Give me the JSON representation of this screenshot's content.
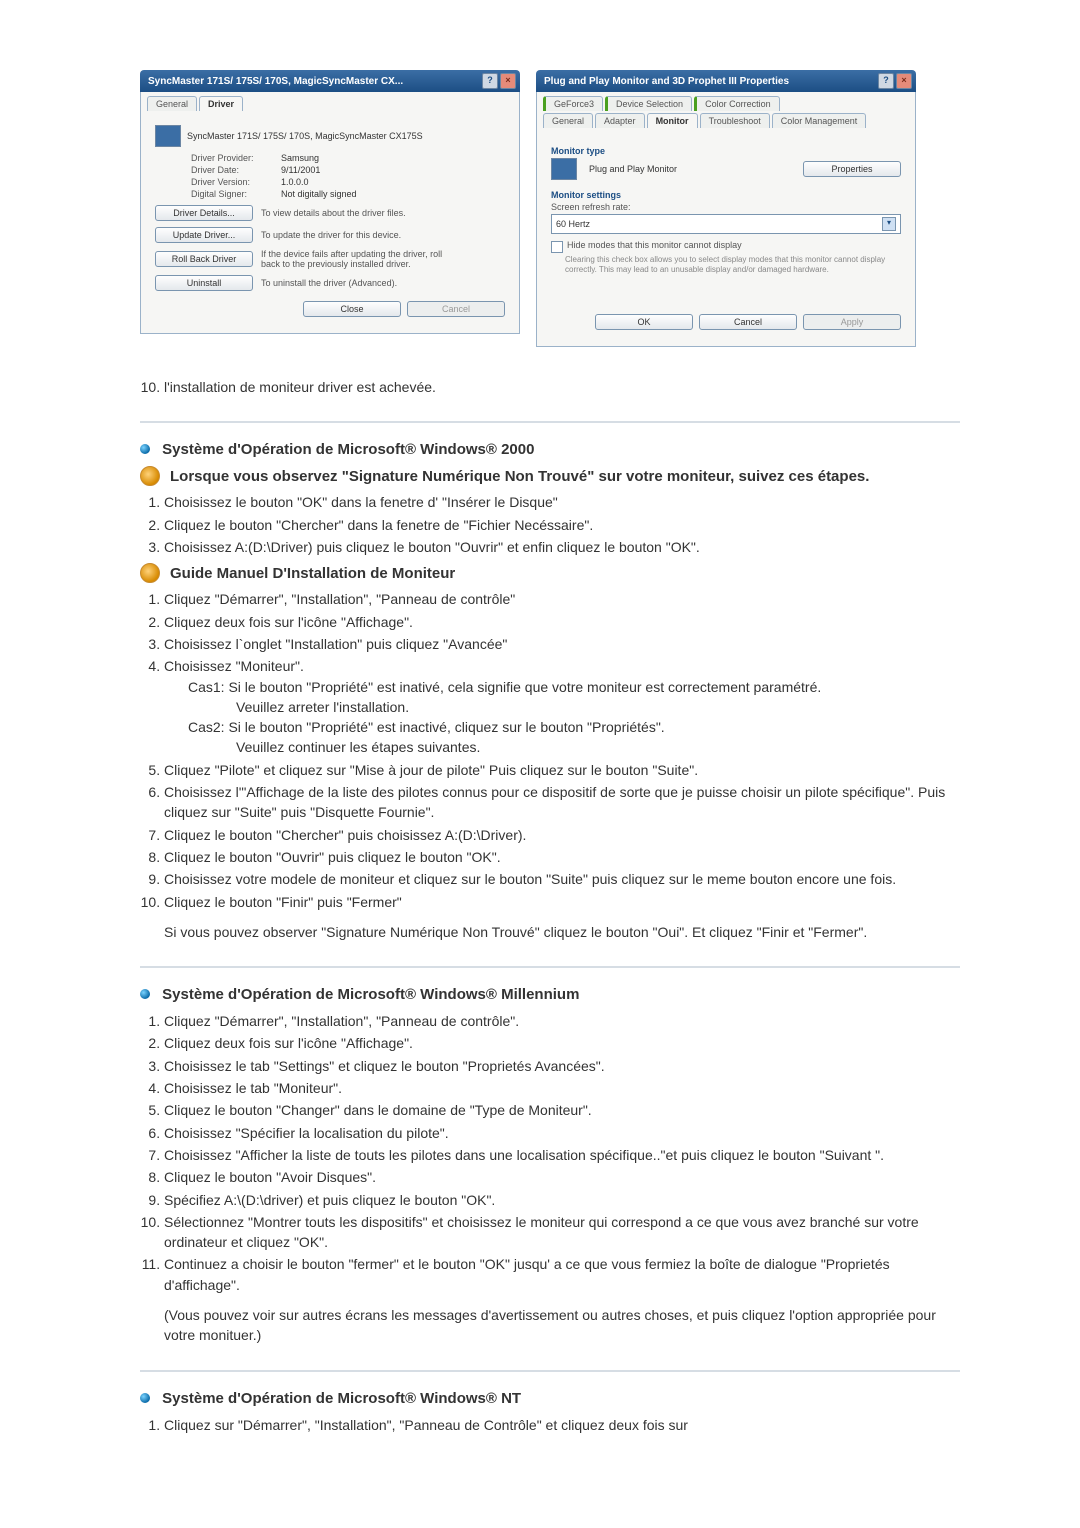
{
  "dlg1": {
    "title": "SyncMaster 171S/ 175S/ 170S, MagicSyncMaster CX...",
    "tabs": {
      "general": "General",
      "driver": "Driver"
    },
    "deviceName": "SyncMaster 171S/ 175S/ 170S, MagicSyncMaster CX175S",
    "kv": {
      "providerLabel": "Driver Provider:",
      "providerValue": "Samsung",
      "dateLabel": "Driver Date:",
      "dateValue": "9/11/2001",
      "versionLabel": "Driver Version:",
      "versionValue": "1.0.0.0",
      "signerLabel": "Digital Signer:",
      "signerValue": "Not digitally signed"
    },
    "acts": {
      "detailsBtn": "Driver Details...",
      "detailsDesc": "To view details about the driver files.",
      "updateBtn": "Update Driver...",
      "updateDesc": "To update the driver for this device.",
      "rollbackBtn": "Roll Back Driver",
      "rollbackDesc": "If the device fails after updating the driver, roll back to the previously installed driver.",
      "uninstallBtn": "Uninstall",
      "uninstallDesc": "To uninstall the driver (Advanced)."
    },
    "close": "Close",
    "cancel": "Cancel"
  },
  "dlg2": {
    "title": "Plug and Play Monitor and 3D Prophet III Properties",
    "tabs": {
      "geforce": "GeForce3",
      "devsel": "Device Selection",
      "colorcorr": "Color Correction",
      "general": "General",
      "adapter": "Adapter",
      "monitor": "Monitor",
      "troubleshoot": "Troubleshoot",
      "colormgmt": "Color Management"
    },
    "monTypeLegend": "Monitor type",
    "monTypeValue": "Plug and Play Monitor",
    "propertiesBtn": "Properties",
    "monSettingsLegend": "Monitor settings",
    "refreshLabel": "Screen refresh rate:",
    "refreshValue": "60 Hertz",
    "hideModes": "Hide modes that this monitor cannot display",
    "hideModesNote": "Clearing this check box allows you to select display modes that this monitor cannot display correctly. This may lead to an unusable display and/or damaged hardware.",
    "ok": "OK",
    "cancel": "Cancel",
    "apply": "Apply"
  },
  "step10": "l'installation de moniteur driver est achevée.",
  "sec2000": {
    "title": "Système d'Opération de Microsoft® Windows® 2000",
    "sigHead": "Lorsque vous observez \"Signature Numérique Non Trouvé\" sur votre moniteur, suivez ces étapes.",
    "sigSteps": [
      "Choisissez le bouton \"OK\" dans la fenetre d' \"Insérer le Disque\"",
      "Cliquez le bouton \"Chercher\" dans la fenetre de \"Fichier Necéssaire\".",
      "Choisissez A:(D:\\Driver) puis cliquez le bouton \"Ouvrir\" et enfin cliquez le bouton \"OK\"."
    ],
    "guideHead": "Guide Manuel D'Installation de Moniteur",
    "guideSteps": {
      "s1": "Cliquez \"Démarrer\", \"Installation\", \"Panneau de contrôle\"",
      "s2": "Cliquez deux fois sur l'icône \"Affichage\".",
      "s3": "Choisissez l`onglet \"Installation\" puis cliquez \"Avancée\"",
      "s4": "Choisissez \"Moniteur\".",
      "s4c1a": "Cas1:  Si le bouton \"Propriété\" est inativé, cela signifie que votre moniteur est correctement paramétré.",
      "s4c1b": "Veuillez arreter l'installation.",
      "s4c2a": "Cas2:  Si le bouton \"Propriété\" est inactivé, cliquez sur le bouton \"Propriétés\".",
      "s4c2b": "Veuillez continuer les étapes suivantes.",
      "s5": "Cliquez \"Pilote\" et cliquez sur \"Mise à jour de pilote\" Puis cliquez sur le bouton \"Suite\".",
      "s6": "Choisissez l'\"Affichage de la liste des pilotes connus pour ce dispositif de sorte que je puisse choisir un pilote spécifique\". Puis cliquez sur \"Suite\" puis \"Disquette Fournie\".",
      "s7": "Cliquez le bouton \"Chercher\" puis choisissez A:(D:\\Driver).",
      "s8": "Cliquez le bouton \"Ouvrir\" puis cliquez le bouton \"OK\".",
      "s9": "Choisissez votre modele de moniteur et cliquez sur le bouton \"Suite\" puis cliquez sur le meme bouton encore une fois.",
      "s10": "Cliquez le bouton \"Finir\" puis \"Fermer\""
    },
    "guideNote": "Si vous pouvez observer \"Signature Numérique Non Trouvé\" cliquez le bouton \"Oui\". Et cliquez \"Finir et \"Fermer\"."
  },
  "secMill": {
    "title": "Système d'Opération de Microsoft® Windows® Millennium",
    "steps": [
      "Cliquez \"Démarrer\", \"Installation\", \"Panneau de contrôle\".",
      "Cliquez deux fois sur l'icône \"Affichage\".",
      "Choisissez le tab \"Settings\" et cliquez le bouton \"Proprietés Avancées\".",
      "Choisissez le tab \"Moniteur\".",
      "Cliquez le bouton \"Changer\" dans le domaine de \"Type de Moniteur\".",
      "Choisissez \"Spécifier la localisation du pilote\".",
      "Choisissez \"Afficher la liste de touts les pilotes dans une localisation spécifique..\"et puis cliquez le bouton \"Suivant \".",
      "Cliquez le bouton \"Avoir Disques\".",
      "Spécifiez A:\\(D:\\driver) et puis cliquez le bouton \"OK\".",
      "Sélectionnez \"Montrer touts les dispositifs\" et choisissez le moniteur qui correspond a ce que vous avez branché sur votre ordinateur et cliquez \"OK\".",
      "Continuez a choisir le bouton \"fermer\" et le bouton \"OK\" jusqu' a ce que vous fermiez la boîte de dialogue \"Proprietés d'affichage\"."
    ],
    "note": "(Vous pouvez voir sur autres écrans les messages d'avertissement ou autres choses, et puis cliquez l'option appropriée pour votre monituer.)"
  },
  "secNT": {
    "title": "Système d'Opération de Microsoft® Windows® NT",
    "steps": [
      "Cliquez sur \"Démarrer\", \"Installation\", \"Panneau de Contrôle\" et cliquez deux fois sur"
    ]
  }
}
